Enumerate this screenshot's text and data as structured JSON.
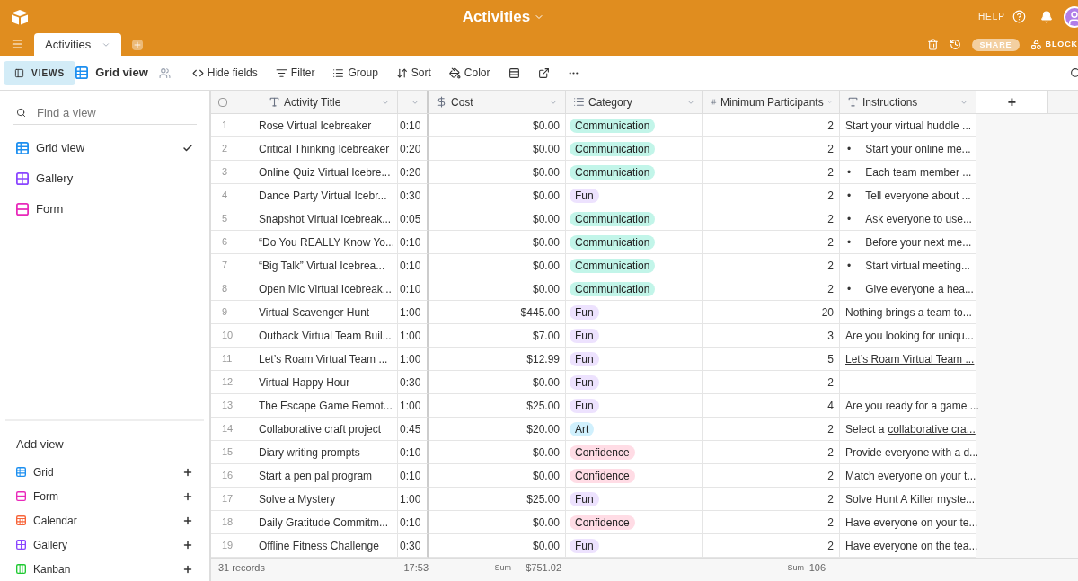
{
  "app_bar": {
    "title": "Activities",
    "help": "HELP"
  },
  "tab_bar": {
    "tabs": [
      {
        "label": "Activities",
        "selected": true
      }
    ],
    "share": "SHARE",
    "blocks": "BLOCK"
  },
  "toolbar": {
    "views_button": "VIEWS",
    "current_view": "Grid view",
    "actions": [
      "Hide fields",
      "Filter",
      "Group",
      "Sort",
      "Color"
    ]
  },
  "sidebar": {
    "search": {
      "placeholder": "Find a view"
    },
    "views": [
      {
        "label": "Grid view",
        "kind": "grid",
        "selected": true
      },
      {
        "label": "Gallery",
        "kind": "gallery",
        "selected": false
      },
      {
        "label": "Form",
        "kind": "form",
        "selected": false
      }
    ],
    "add_view_title": "Add view",
    "add_items": [
      {
        "label": "Grid",
        "kind": "grid"
      },
      {
        "label": "Form",
        "kind": "form"
      },
      {
        "label": "Calendar",
        "kind": "calendar"
      },
      {
        "label": "Gallery",
        "kind": "gallery"
      },
      {
        "label": "Kanban",
        "kind": "kanban"
      }
    ]
  },
  "table": {
    "select_all": {
      "checked": false
    },
    "columns": [
      {
        "label": "Activity Title",
        "kind": "text"
      },
      {
        "kind": "blank"
      },
      {
        "label": "Cost",
        "kind": "currency"
      },
      {
        "label": "Category",
        "kind": "select"
      },
      {
        "label": "Minimum Participants",
        "kind": "number"
      },
      {
        "label": "Instructions",
        "kind": "longtext"
      }
    ],
    "add_column": "+",
    "rows": [
      {
        "num": "1",
        "title": "Rose Virtual Icebreaker",
        "time": "0:10",
        "cost": "$0.00",
        "category": {
          "label": "Communication",
          "color": "#c2f5e9"
        },
        "min": "2",
        "instructions": {
          "kind": "plain",
          "text": "Start your virtual huddle ..."
        }
      },
      {
        "num": "2",
        "title": "Critical Thinking Icebreaker",
        "time": "0:20",
        "cost": "$0.00",
        "category": {
          "label": "Communication",
          "color": "#c2f5e9"
        },
        "min": "2",
        "instructions": {
          "kind": "bullet",
          "marker": "•",
          "text": "Start your online me..."
        }
      },
      {
        "num": "3",
        "title": "Online Quiz Virtual Icebre...",
        "time": "0:20",
        "cost": "$0.00",
        "category": {
          "label": "Communication",
          "color": "#c2f5e9"
        },
        "min": "2",
        "instructions": {
          "kind": "bullet",
          "marker": "•",
          "text": "Each team member ..."
        }
      },
      {
        "num": "4",
        "title": "Dance Party Virtual Icebr...",
        "time": "0:30",
        "cost": "$0.00",
        "category": {
          "label": "Fun",
          "color": "#ede2fe"
        },
        "min": "2",
        "instructions": {
          "kind": "bullet",
          "marker": "•",
          "text": "Tell everyone about ..."
        }
      },
      {
        "num": "5",
        "title": "Snapshot Virtual Icebreak...",
        "time": "0:05",
        "cost": "$0.00",
        "category": {
          "label": "Communication",
          "color": "#c2f5e9"
        },
        "min": "2",
        "instructions": {
          "kind": "bullet",
          "marker": "•",
          "text": "Ask everyone to use..."
        }
      },
      {
        "num": "6",
        "title": "“Do You REALLY Know Yo...",
        "time": "0:10",
        "cost": "$0.00",
        "category": {
          "label": "Communication",
          "color": "#c2f5e9"
        },
        "min": "2",
        "instructions": {
          "kind": "bullet",
          "marker": "•",
          "text": "Before your next me..."
        }
      },
      {
        "num": "7",
        "title": "“Big Talk” Virtual Icebrea...",
        "time": "0:10",
        "cost": "$0.00",
        "category": {
          "label": "Communication",
          "color": "#c2f5e9"
        },
        "min": "2",
        "instructions": {
          "kind": "bullet",
          "marker": "•",
          "text": "Start virtual meeting..."
        }
      },
      {
        "num": "8",
        "title": "Open Mic Virtual Icebreak...",
        "time": "0:10",
        "cost": "$0.00",
        "category": {
          "label": "Communication",
          "color": "#c2f5e9"
        },
        "min": "2",
        "instructions": {
          "kind": "bullet",
          "marker": "•",
          "text": "Give everyone a hea..."
        }
      },
      {
        "num": "9",
        "title": "Virtual Scavenger Hunt",
        "time": "1:00",
        "cost": "$445.00",
        "category": {
          "label": "Fun",
          "color": "#ede2fe"
        },
        "min": "20",
        "instructions": {
          "kind": "plain",
          "text": "Nothing brings a team to..."
        }
      },
      {
        "num": "10",
        "title": "Outback Virtual Team Buil...",
        "time": "1:00",
        "cost": "$7.00",
        "category": {
          "label": "Fun",
          "color": "#ede2fe"
        },
        "min": "3",
        "instructions": {
          "kind": "plain",
          "text": "Are you looking for uniqu..."
        }
      },
      {
        "num": "11",
        "title": "Let’s Roam Virtual Team ...",
        "time": "1:00",
        "cost": "$12.99",
        "category": {
          "label": "Fun",
          "color": "#ede2fe"
        },
        "min": "5",
        "instructions": {
          "kind": "link",
          "text": "Let’s Roam Virtual Team ..."
        }
      },
      {
        "num": "12",
        "title": "Virtual Happy Hour",
        "time": "0:30",
        "cost": "$0.00",
        "category": {
          "label": "Fun",
          "color": "#ede2fe"
        },
        "min": "2"
      },
      {
        "num": "13",
        "title": "The Escape Game Remot...",
        "time": "1:00",
        "cost": "$25.00",
        "category": {
          "label": "Fun",
          "color": "#ede2fe"
        },
        "min": "4",
        "instructions": {
          "kind": "plain",
          "text": "Are you ready for a game ..."
        }
      },
      {
        "num": "14",
        "title": "Collaborative craft project",
        "time": "0:45",
        "cost": "$20.00",
        "category": {
          "label": "Art",
          "color": "#d0f0fd"
        },
        "min": "2",
        "instructions": {
          "kind": "mixed",
          "text": "Select a",
          "link": "collaborative cra..."
        }
      },
      {
        "num": "15",
        "title": "Diary writing prompts",
        "time": "0:10",
        "cost": "$0.00",
        "category": {
          "label": "Confidence",
          "color": "#ffdce5"
        },
        "min": "2",
        "instructions": {
          "kind": "plain",
          "text": "Provide everyone with a d..."
        }
      },
      {
        "num": "16",
        "title": "Start a pen pal program",
        "time": "0:10",
        "cost": "$0.00",
        "category": {
          "label": "Confidence",
          "color": "#ffdce5"
        },
        "min": "2",
        "instructions": {
          "kind": "plain",
          "text": "Match everyone on your t..."
        }
      },
      {
        "num": "17",
        "title": "Solve a Mystery",
        "time": "1:00",
        "cost": "$25.00",
        "category": {
          "label": "Fun",
          "color": "#ede2fe"
        },
        "min": "2",
        "instructions": {
          "kind": "plain",
          "text": "Solve Hunt A Killer myste..."
        }
      },
      {
        "num": "18",
        "title": "Daily Gratitude Commitm...",
        "time": "0:10",
        "cost": "$0.00",
        "category": {
          "label": "Confidence",
          "color": "#ffdce5"
        },
        "min": "2",
        "instructions": {
          "kind": "plain",
          "text": "Have everyone on your te..."
        }
      },
      {
        "num": "19",
        "title": "Offline Fitness Challenge",
        "time": "0:30",
        "cost": "$0.00",
        "category": {
          "label": "Fun",
          "color": "#ede2fe"
        },
        "min": "2",
        "instructions": {
          "kind": "plain",
          "text": "Have everyone on the tea..."
        }
      }
    ],
    "footer": {
      "records": "31 records",
      "time_total": "17:53",
      "cost_label": "Sum",
      "cost_total": "$751.02",
      "min_label": "Sum",
      "min_total": "106"
    }
  }
}
